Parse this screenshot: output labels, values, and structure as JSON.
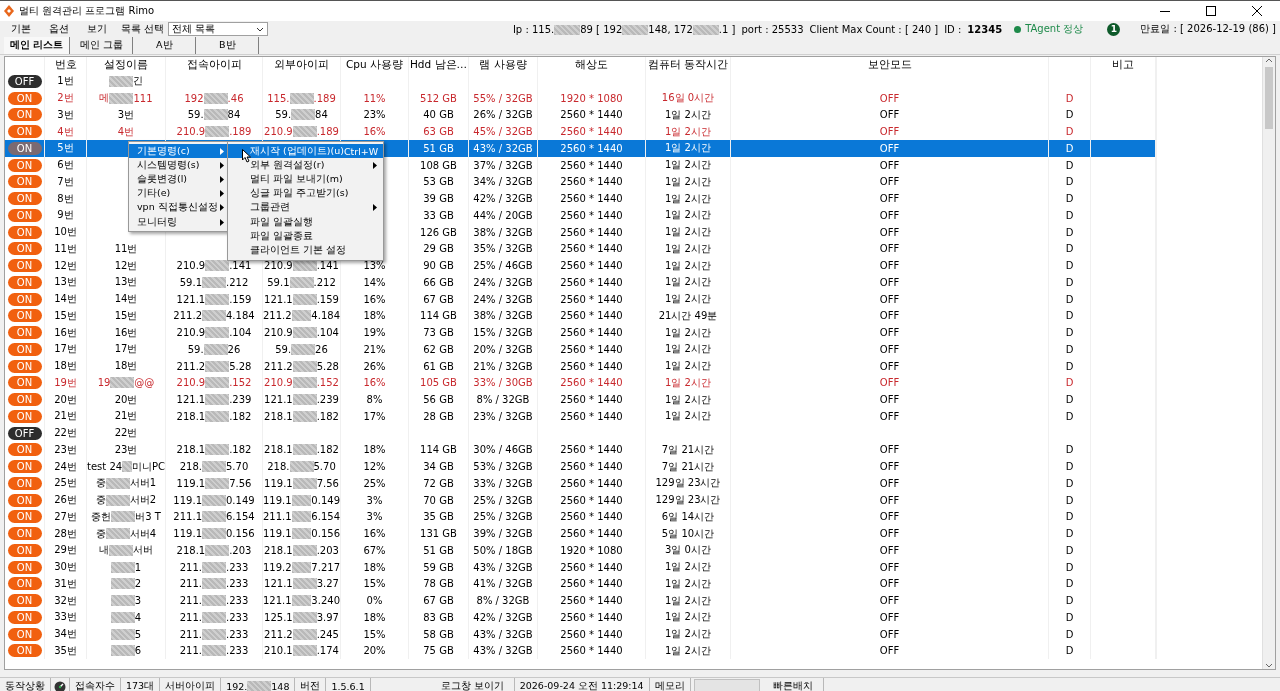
{
  "window": {
    "title": "멀티 원격관리 프로그램 Rimo"
  },
  "menu_bar": {
    "items": [
      "기본",
      "옵션",
      "보기"
    ],
    "list_label": "목록 선택",
    "list_value": "전체 목록"
  },
  "server_info": {
    "ip": {
      "parts": [
        "Ip : 115.",
        "89 [ 192",
        "148, 172",
        ".1 ]"
      ],
      "lead": false
    },
    "port": "port : 25533",
    "max_count": "Client Max Count :  [ 240 ]",
    "id_label": "ID :",
    "id": "12345",
    "agent": "TAgent 정상",
    "badge": "1",
    "expiry": "만료일 : [ 2026-12-19 (86) ]"
  },
  "tabs": [
    {
      "label": "메인 리스트",
      "selected": true
    },
    {
      "label": "메인 그룹",
      "selected": false
    },
    {
      "label": "A반",
      "selected": false
    },
    {
      "label": "B반",
      "selected": false
    }
  ],
  "table": {
    "columns": [
      "번호",
      "설정이름",
      "접속아이피",
      "외부아이피",
      "Cpu 사용량",
      "Hdd 남은…",
      "램 사용량",
      "해상도",
      "컴퓨터 동작시간",
      "보안모드",
      "비고"
    ],
    "rows": [
      {
        "power": "OFF",
        "on": false,
        "selected": false,
        "alert": false,
        "cells": [
          "1번",
          {
            "parts": [
              "긴"
            ],
            "lead": true
          },
          null,
          null,
          null,
          null,
          null,
          null,
          null,
          null,
          null
        ]
      },
      {
        "power": "ON",
        "on": true,
        "selected": false,
        "alert": true,
        "cells": [
          "2번",
          {
            "parts": [
              "메",
              "111"
            ],
            "lead": false
          },
          {
            "parts": [
              "192",
              ".46"
            ],
            "lead": false
          },
          {
            "parts": [
              "115.",
              ".189"
            ],
            "lead": false
          },
          "11%",
          "512 GB",
          "55% / 32GB",
          "1920 * 1080",
          "16일 0시간",
          "OFF",
          "D"
        ]
      },
      {
        "power": "ON",
        "on": true,
        "selected": false,
        "alert": false,
        "cells": [
          "3번",
          "3번",
          {
            "parts": [
              "59.",
              "84"
            ],
            "lead": false
          },
          {
            "parts": [
              "59.",
              "84"
            ],
            "lead": false
          },
          "23%",
          "40 GB",
          "26% / 32GB",
          "2560 * 1440",
          "1일 2시간",
          "OFF",
          "D"
        ]
      },
      {
        "power": "ON",
        "on": true,
        "selected": false,
        "alert": true,
        "cells": [
          "4번",
          "4번",
          {
            "parts": [
              "210.9",
              ".189"
            ],
            "lead": false
          },
          {
            "parts": [
              "210.9",
              ".189"
            ],
            "lead": false
          },
          "16%",
          "63 GB",
          "45% / 32GB",
          "2560 * 1440",
          "1일 2시간",
          "OFF",
          "D"
        ]
      },
      {
        "power": "ON",
        "on": true,
        "selected": true,
        "alert": false,
        "cells": [
          "5번",
          null,
          null,
          null,
          null,
          "51 GB",
          "43% / 32GB",
          "2560 * 1440",
          "1일 2시간",
          "OFF",
          "D"
        ]
      },
      {
        "power": "ON",
        "on": true,
        "selected": false,
        "alert": false,
        "cells": [
          "6번",
          null,
          null,
          null,
          null,
          "108 GB",
          "37% / 32GB",
          "2560 * 1440",
          "1일 2시간",
          "OFF",
          "D"
        ]
      },
      {
        "power": "ON",
        "on": true,
        "selected": false,
        "alert": false,
        "cells": [
          "7번",
          null,
          null,
          null,
          null,
          "53 GB",
          "34% / 32GB",
          "2560 * 1440",
          "1일 2시간",
          "OFF",
          "D"
        ]
      },
      {
        "power": "ON",
        "on": true,
        "selected": false,
        "alert": false,
        "cells": [
          "8번",
          null,
          null,
          null,
          null,
          "39 GB",
          "42% / 32GB",
          "2560 * 1440",
          "1일 2시간",
          "OFF",
          "D"
        ]
      },
      {
        "power": "ON",
        "on": true,
        "selected": false,
        "alert": false,
        "cells": [
          "9번",
          null,
          null,
          null,
          null,
          "33 GB",
          "44% / 20GB",
          "2560 * 1440",
          "1일 2시간",
          "OFF",
          "D"
        ]
      },
      {
        "power": "ON",
        "on": true,
        "selected": false,
        "alert": false,
        "cells": [
          "10번",
          null,
          null,
          null,
          null,
          "126 GB",
          "38% / 32GB",
          "2560 * 1440",
          "1일 2시간",
          "OFF",
          "D"
        ]
      },
      {
        "power": "ON",
        "on": true,
        "selected": false,
        "alert": false,
        "cells": [
          "11번",
          "11번",
          null,
          null,
          null,
          "29 GB",
          "35% / 32GB",
          "2560 * 1440",
          "1일 2시간",
          "OFF",
          "D"
        ]
      },
      {
        "power": "ON",
        "on": true,
        "selected": false,
        "alert": false,
        "cells": [
          "12번",
          "12번",
          {
            "parts": [
              "210.9",
              ".141"
            ],
            "lead": false
          },
          {
            "parts": [
              "210.9",
              ".141"
            ],
            "lead": false
          },
          "13%",
          "90 GB",
          "25% / 46GB",
          "2560 * 1440",
          "1일 2시간",
          "OFF",
          "D"
        ]
      },
      {
        "power": "ON",
        "on": true,
        "selected": false,
        "alert": false,
        "cells": [
          "13번",
          "13번",
          {
            "parts": [
              "59.1",
              ".212"
            ],
            "lead": false
          },
          {
            "parts": [
              "59.1",
              ".212"
            ],
            "lead": false
          },
          "14%",
          "66 GB",
          "24% / 32GB",
          "2560 * 1440",
          "1일 2시간",
          "OFF",
          "D"
        ]
      },
      {
        "power": "ON",
        "on": true,
        "selected": false,
        "alert": false,
        "cells": [
          "14번",
          "14번",
          {
            "parts": [
              "121.1",
              ".159"
            ],
            "lead": false
          },
          {
            "parts": [
              "121.1",
              ".159"
            ],
            "lead": false
          },
          "16%",
          "67 GB",
          "24% / 32GB",
          "2560 * 1440",
          "1일 2시간",
          "OFF",
          "D"
        ]
      },
      {
        "power": "ON",
        "on": true,
        "selected": false,
        "alert": false,
        "cells": [
          "15번",
          "15번",
          {
            "parts": [
              "211.2",
              "4.184"
            ],
            "lead": false
          },
          {
            "parts": [
              "211.2",
              "4.184"
            ],
            "lead": false
          },
          "18%",
          "114 GB",
          "38% / 32GB",
          "2560 * 1440",
          "21시간 49분",
          "OFF",
          "D"
        ]
      },
      {
        "power": "ON",
        "on": true,
        "selected": false,
        "alert": false,
        "cells": [
          "16번",
          "16번",
          {
            "parts": [
              "210.9",
              ".104"
            ],
            "lead": false
          },
          {
            "parts": [
              "210.9",
              ".104"
            ],
            "lead": false
          },
          "19%",
          "73 GB",
          "15% / 32GB",
          "2560 * 1440",
          "1일 2시간",
          "OFF",
          "D"
        ]
      },
      {
        "power": "ON",
        "on": true,
        "selected": false,
        "alert": false,
        "cells": [
          "17번",
          "17번",
          {
            "parts": [
              "59.",
              "26"
            ],
            "lead": false
          },
          {
            "parts": [
              "59.",
              "26"
            ],
            "lead": false
          },
          "21%",
          "62 GB",
          "20% / 32GB",
          "2560 * 1440",
          "1일 2시간",
          "OFF",
          "D"
        ]
      },
      {
        "power": "ON",
        "on": true,
        "selected": false,
        "alert": false,
        "cells": [
          "18번",
          "18번",
          {
            "parts": [
              "211.2",
              "5.28"
            ],
            "lead": false
          },
          {
            "parts": [
              "211.2",
              "5.28"
            ],
            "lead": false
          },
          "26%",
          "61 GB",
          "21% / 32GB",
          "2560 * 1440",
          "1일 2시간",
          "OFF",
          "D"
        ]
      },
      {
        "power": "ON",
        "on": true,
        "selected": false,
        "alert": true,
        "cells": [
          "19번",
          {
            "parts": [
              "19",
              "@@"
            ],
            "lead": false
          },
          {
            "parts": [
              "210.9",
              ".152"
            ],
            "lead": false
          },
          {
            "parts": [
              "210.9",
              ".152"
            ],
            "lead": false
          },
          "16%",
          "105 GB",
          "33% / 30GB",
          "2560 * 1440",
          "1일 2시간",
          "OFF",
          "D"
        ]
      },
      {
        "power": "ON",
        "on": true,
        "selected": false,
        "alert": false,
        "cells": [
          "20번",
          "20번",
          {
            "parts": [
              "121.1",
              ".239"
            ],
            "lead": false
          },
          {
            "parts": [
              "121.1",
              ".239"
            ],
            "lead": false
          },
          "8%",
          "56 GB",
          "8% / 32GB",
          "2560 * 1440",
          "1일 2시간",
          "OFF",
          "D"
        ]
      },
      {
        "power": "ON",
        "on": true,
        "selected": false,
        "alert": false,
        "cells": [
          "21번",
          "21번",
          {
            "parts": [
              "218.1",
              ".182"
            ],
            "lead": false
          },
          {
            "parts": [
              "218.1",
              ".182"
            ],
            "lead": false
          },
          "17%",
          "28 GB",
          "23% / 32GB",
          "2560 * 1440",
          "1일 2시간",
          "OFF",
          "D"
        ]
      },
      {
        "power": "OFF",
        "on": false,
        "selected": false,
        "alert": false,
        "cells": [
          "22번",
          "22번",
          null,
          null,
          null,
          null,
          null,
          null,
          null,
          null,
          null
        ]
      },
      {
        "power": "ON",
        "on": true,
        "selected": false,
        "alert": false,
        "cells": [
          "23번",
          "23번",
          {
            "parts": [
              "218.1",
              ".182"
            ],
            "lead": false
          },
          {
            "parts": [
              "218.1",
              ".182"
            ],
            "lead": false
          },
          "18%",
          "114 GB",
          "30% / 46GB",
          "2560 * 1440",
          "7일 21시간",
          "OFF",
          "D"
        ]
      },
      {
        "power": "ON",
        "on": true,
        "selected": false,
        "alert": false,
        "cells": [
          "24번",
          {
            "parts": [
              "test 24",
              " 미니PC"
            ],
            "lead": false
          },
          {
            "parts": [
              "218.",
              "5.70"
            ],
            "lead": false
          },
          {
            "parts": [
              "218.",
              "5.70"
            ],
            "lead": false
          },
          "12%",
          "34 GB",
          "53% / 32GB",
          "2560 * 1440",
          "7일 21시간",
          "OFF",
          "D"
        ]
      },
      {
        "power": "ON",
        "on": true,
        "selected": false,
        "alert": false,
        "cells": [
          "25번",
          {
            "parts": [
              "중",
              "서버1"
            ],
            "lead": false
          },
          {
            "parts": [
              "119.1",
              "7.56"
            ],
            "lead": false
          },
          {
            "parts": [
              "119.1",
              "7.56"
            ],
            "lead": false
          },
          "25%",
          "72 GB",
          "33% / 32GB",
          "2560 * 1440",
          "129일 23시간",
          "OFF",
          "D"
        ]
      },
      {
        "power": "ON",
        "on": true,
        "selected": false,
        "alert": false,
        "cells": [
          "26번",
          {
            "parts": [
              "중",
              "서버2"
            ],
            "lead": false
          },
          {
            "parts": [
              "119.1",
              "0.149"
            ],
            "lead": false
          },
          {
            "parts": [
              "119.1",
              "0.149"
            ],
            "lead": false
          },
          "3%",
          "70 GB",
          "25% / 32GB",
          "2560 * 1440",
          "129일 23시간",
          "OFF",
          "D"
        ]
      },
      {
        "power": "ON",
        "on": true,
        "selected": false,
        "alert": false,
        "cells": [
          "27번",
          {
            "parts": [
              "중헌",
              "버3 T"
            ],
            "lead": false
          },
          {
            "parts": [
              "211.1",
              "6.154"
            ],
            "lead": false
          },
          {
            "parts": [
              "211.1",
              "6.154"
            ],
            "lead": false
          },
          "3%",
          "35 GB",
          "25% / 32GB",
          "2560 * 1440",
          "6일 14시간",
          "OFF",
          "D"
        ]
      },
      {
        "power": "ON",
        "on": true,
        "selected": false,
        "alert": false,
        "cells": [
          "28번",
          {
            "parts": [
              "중",
              "서버4"
            ],
            "lead": false
          },
          {
            "parts": [
              "119.1",
              "0.156"
            ],
            "lead": false
          },
          {
            "parts": [
              "119.1",
              "0.156"
            ],
            "lead": false
          },
          "16%",
          "131 GB",
          "39% / 32GB",
          "2560 * 1440",
          "5일 10시간",
          "OFF",
          "D"
        ]
      },
      {
        "power": "ON",
        "on": true,
        "selected": false,
        "alert": false,
        "cells": [
          "29번",
          {
            "parts": [
              "내",
              "서버"
            ],
            "lead": false
          },
          {
            "parts": [
              "218.1",
              ".203"
            ],
            "lead": false
          },
          {
            "parts": [
              "218.1",
              ".203"
            ],
            "lead": false
          },
          "67%",
          "51 GB",
          "50% / 18GB",
          "1920 * 1080",
          "3일 0시간",
          "OFF",
          "D"
        ]
      },
      {
        "power": "ON",
        "on": true,
        "selected": false,
        "alert": false,
        "cells": [
          "30번",
          {
            "parts": [
              "1"
            ],
            "lead": true
          },
          {
            "parts": [
              "211.",
              ".233"
            ],
            "lead": false
          },
          {
            "parts": [
              "119.2",
              "7.217"
            ],
            "lead": false
          },
          "18%",
          "59 GB",
          "43% / 32GB",
          "2560 * 1440",
          "1일 2시간",
          "OFF",
          "D"
        ]
      },
      {
        "power": "ON",
        "on": true,
        "selected": false,
        "alert": false,
        "cells": [
          "31번",
          {
            "parts": [
              "2"
            ],
            "lead": true
          },
          {
            "parts": [
              "211.",
              ".233"
            ],
            "lead": false
          },
          {
            "parts": [
              "121.1",
              "3.27"
            ],
            "lead": false
          },
          "15%",
          "78 GB",
          "41% / 32GB",
          "2560 * 1440",
          "1일 2시간",
          "OFF",
          "D"
        ]
      },
      {
        "power": "ON",
        "on": true,
        "selected": false,
        "alert": false,
        "cells": [
          "32번",
          {
            "parts": [
              "3"
            ],
            "lead": true
          },
          {
            "parts": [
              "211.",
              ".233"
            ],
            "lead": false
          },
          {
            "parts": [
              "121.1",
              "3.240"
            ],
            "lead": false
          },
          "0%",
          "67 GB",
          "8% / 32GB",
          "2560 * 1440",
          "1일 2시간",
          "OFF",
          "D"
        ]
      },
      {
        "power": "ON",
        "on": true,
        "selected": false,
        "alert": false,
        "cells": [
          "33번",
          {
            "parts": [
              "4"
            ],
            "lead": true
          },
          {
            "parts": [
              "211.",
              ".233"
            ],
            "lead": false
          },
          {
            "parts": [
              "125.1",
              "3.97"
            ],
            "lead": false
          },
          "18%",
          "83 GB",
          "42% / 32GB",
          "2560 * 1440",
          "1일 2시간",
          "OFF",
          "D"
        ]
      },
      {
        "power": "ON",
        "on": true,
        "selected": false,
        "alert": false,
        "cells": [
          "34번",
          {
            "parts": [
              "5"
            ],
            "lead": true
          },
          {
            "parts": [
              "211.",
              ".233"
            ],
            "lead": false
          },
          {
            "parts": [
              "211.2",
              ".245"
            ],
            "lead": false
          },
          "15%",
          "58 GB",
          "43% / 32GB",
          "2560 * 1440",
          "1일 2시간",
          "OFF",
          "D"
        ]
      },
      {
        "power": "ON",
        "on": true,
        "selected": false,
        "alert": false,
        "cells": [
          "35번",
          {
            "parts": [
              "6"
            ],
            "lead": true
          },
          {
            "parts": [
              "211.",
              ".233"
            ],
            "lead": false
          },
          {
            "parts": [
              "210.1",
              ".174"
            ],
            "lead": false
          },
          "20%",
          "75 GB",
          "43% / 32GB",
          "2560 * 1440",
          "1일 2시간",
          "OFF",
          "D"
        ]
      }
    ]
  },
  "context_menu": {
    "items": [
      {
        "label": "기본명령(c)",
        "submenu": true,
        "selected": true
      },
      {
        "label": "시스템명령(s)",
        "submenu": true,
        "selected": false
      },
      {
        "label": "슬롯변경(l)",
        "submenu": true,
        "selected": false
      },
      {
        "label": "기타(e)",
        "submenu": true,
        "selected": false
      },
      {
        "label": "vpn 직접통신설정",
        "submenu": true,
        "selected": false
      },
      {
        "label": "모니터링",
        "submenu": true,
        "selected": false
      }
    ]
  },
  "submenu": {
    "items": [
      {
        "label": "재시작 (업데이트)(u)",
        "shortcut": "Ctrl+W",
        "submenu": false,
        "selected": true
      },
      {
        "label": "외부 원격설정(r)",
        "submenu": true,
        "selected": false
      },
      {
        "label": "멀티 파일 보내기(m)",
        "submenu": false,
        "selected": false
      },
      {
        "label": "싱글 파일 주고받기(s)",
        "submenu": false,
        "selected": false
      },
      {
        "label": "그룹관련",
        "submenu": true,
        "selected": false
      },
      {
        "label": "파일 일괄실행",
        "submenu": false,
        "selected": false
      },
      {
        "label": "파일 일괄종료",
        "submenu": false,
        "selected": false
      },
      {
        "label": "클라이언트 기본 설정",
        "submenu": false,
        "selected": false
      }
    ]
  },
  "status_bar": {
    "items": [
      {
        "kind": "label",
        "text": "동작상황"
      },
      {
        "kind": "indicator"
      },
      {
        "kind": "label",
        "text": "접속자수"
      },
      {
        "kind": "value",
        "text": "173대"
      },
      {
        "kind": "label",
        "text": "서버아이피"
      },
      {
        "kind": "value",
        "masked": {
          "parts": [
            "192.",
            "148"
          ],
          "lead": false
        }
      },
      {
        "kind": "label",
        "text": "버전"
      },
      {
        "kind": "value",
        "text": "1.5.6.1"
      },
      {
        "kind": "spacer"
      },
      {
        "kind": "button",
        "text": "로그창 보이기"
      },
      {
        "kind": "value",
        "text": "2026-09-24 오전 11:29:14"
      },
      {
        "kind": "label",
        "text": "메모리"
      },
      {
        "kind": "meter"
      },
      {
        "kind": "button",
        "text": "빠른배치"
      }
    ]
  }
}
